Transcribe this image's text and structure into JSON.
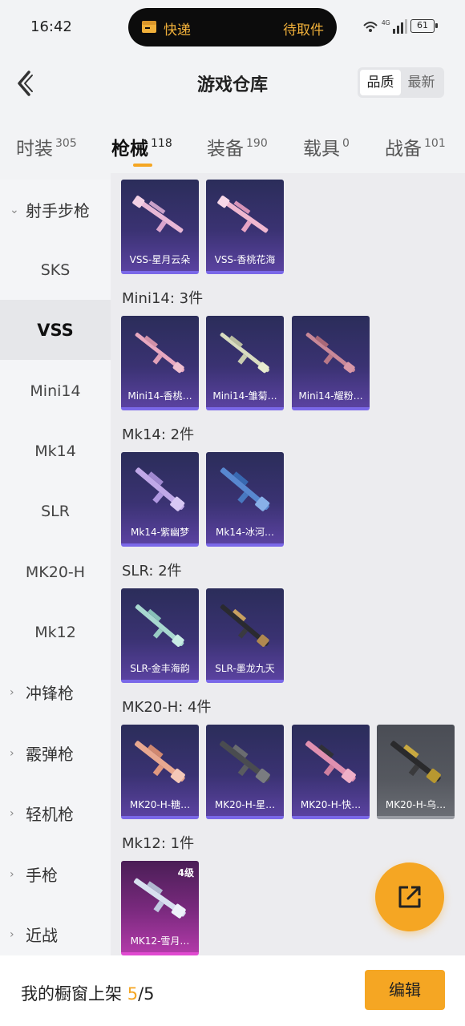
{
  "status_bar": {
    "time": "16:42",
    "notice_left": "快递",
    "notice_right": "待取件",
    "battery": "61",
    "network": "4G"
  },
  "header": {
    "title": "游戏仓库",
    "sort_options": [
      "品质",
      "最新"
    ],
    "sort_active": "品质"
  },
  "tabs": [
    {
      "label": "时装",
      "count": "305"
    },
    {
      "label": "枪械",
      "count": "118"
    },
    {
      "label": "装备",
      "count": "190"
    },
    {
      "label": "载具",
      "count": "0"
    },
    {
      "label": "战备",
      "count": "101"
    }
  ],
  "active_tab": "枪械",
  "sidebar": {
    "expanded_group": "射手步枪",
    "sub_items": [
      "SKS",
      "VSS",
      "Mini14",
      "Mk14",
      "SLR",
      "MK20-H",
      "Mk12"
    ],
    "active_item": "VSS",
    "collapsed_groups": [
      "冲锋枪",
      "霰弹枪",
      "轻机枪",
      "手枪",
      "近战"
    ]
  },
  "sections": [
    {
      "title": "",
      "items": [
        {
          "name": "VSS-星月云朵"
        },
        {
          "name": "VSS-香桃花海"
        }
      ]
    },
    {
      "title": "Mini14: 3件",
      "items": [
        {
          "name": "Mini14-香桃…"
        },
        {
          "name": "Mini14-雏菊…"
        },
        {
          "name": "Mini14-耀粉…"
        }
      ]
    },
    {
      "title": "Mk14: 2件",
      "items": [
        {
          "name": "Mk14-紫幽梦"
        },
        {
          "name": "Mk14-冰河…"
        }
      ]
    },
    {
      "title": "SLR: 2件",
      "items": [
        {
          "name": "SLR-金丰海韵"
        },
        {
          "name": "SLR-墨龙九天"
        }
      ]
    },
    {
      "title": "MK20-H: 4件",
      "items": [
        {
          "name": "MK20-H-糖…"
        },
        {
          "name": "MK20-H-星…"
        },
        {
          "name": "MK20-H-快…"
        },
        {
          "name": "MK20-H-乌…"
        }
      ]
    },
    {
      "title": "Mk12: 1件",
      "items": [
        {
          "name": "MK12-雪月…",
          "level": "4级"
        }
      ]
    }
  ],
  "footer": {
    "label": "我的橱窗上架",
    "current": "5",
    "separator": "/",
    "total": "5",
    "edit_label": "编辑"
  }
}
